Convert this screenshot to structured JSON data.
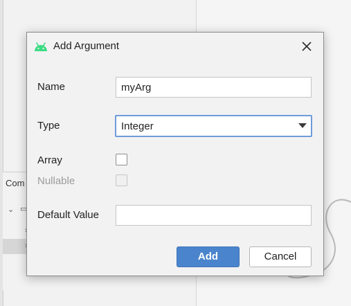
{
  "background": {
    "tree_header": "Com",
    "title_icon": "android-icon"
  },
  "dialog": {
    "title": "Add Argument",
    "close_icon": "close-icon",
    "fields": {
      "name_label": "Name",
      "name_value": "myArg",
      "type_label": "Type",
      "type_value": "Integer",
      "array_label": "Array",
      "array_checked": false,
      "nullable_label": "Nullable",
      "nullable_checked": false,
      "nullable_enabled": false,
      "default_label": "Default Value",
      "default_value": ""
    },
    "buttons": {
      "add": "Add",
      "cancel": "Cancel"
    }
  },
  "colors": {
    "primary_button": "#4a84cc",
    "focus_border": "#6d9bd8",
    "android_green": "#3ddc84"
  }
}
